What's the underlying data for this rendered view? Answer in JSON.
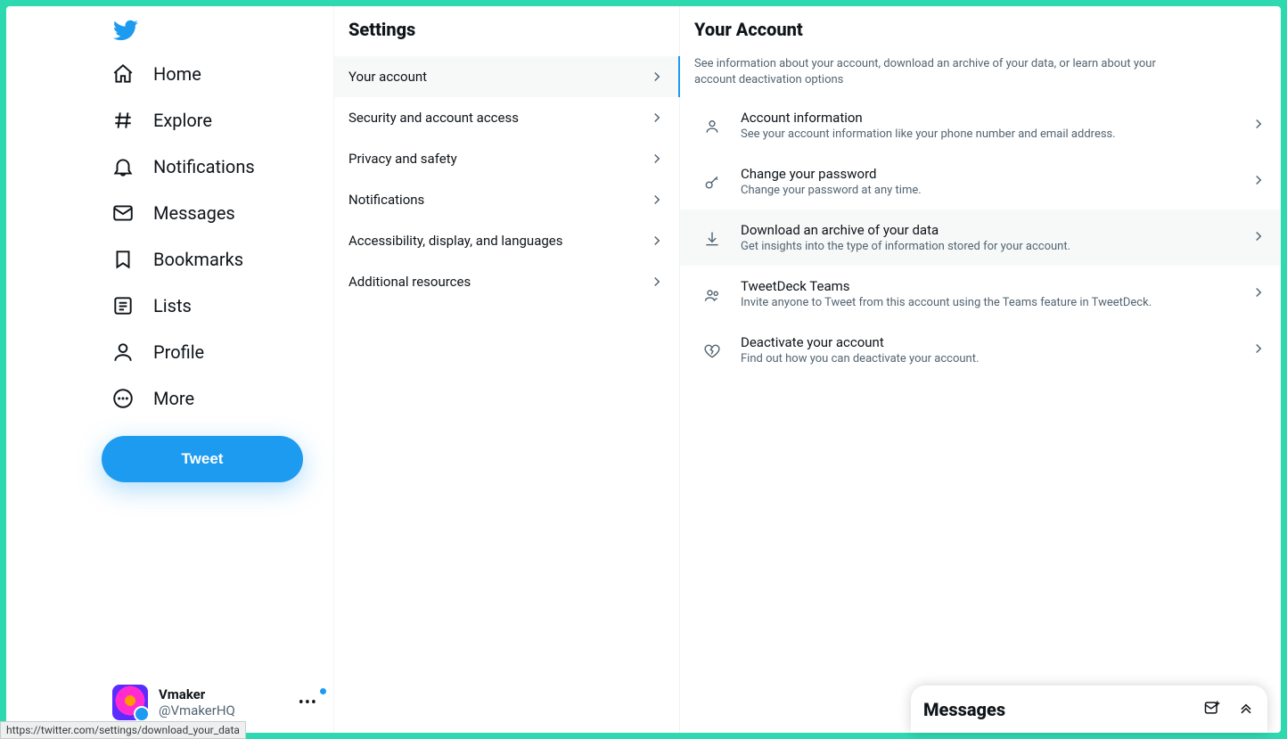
{
  "nav": {
    "items": [
      {
        "label": "Home"
      },
      {
        "label": "Explore"
      },
      {
        "label": "Notifications"
      },
      {
        "label": "Messages"
      },
      {
        "label": "Bookmarks"
      },
      {
        "label": "Lists"
      },
      {
        "label": "Profile"
      },
      {
        "label": "More"
      }
    ],
    "tweet_label": "Tweet"
  },
  "account": {
    "name": "Vmaker",
    "handle": "@VmakerHQ"
  },
  "settings": {
    "title": "Settings",
    "items": [
      {
        "label": "Your account"
      },
      {
        "label": "Security and account access"
      },
      {
        "label": "Privacy and safety"
      },
      {
        "label": "Notifications"
      },
      {
        "label": "Accessibility, display, and languages"
      },
      {
        "label": "Additional resources"
      }
    ]
  },
  "detail": {
    "title": "Your Account",
    "description": "See information about your account, download an archive of your data, or learn about your account deactivation options",
    "options": [
      {
        "title": "Account information",
        "sub": "See your account information like your phone number and email address."
      },
      {
        "title": "Change your password",
        "sub": "Change your password at any time."
      },
      {
        "title": "Download an archive of your data",
        "sub": "Get insights into the type of information stored for your account."
      },
      {
        "title": "TweetDeck Teams",
        "sub": "Invite anyone to Tweet from this account using the Teams feature in TweetDeck."
      },
      {
        "title": "Deactivate your account",
        "sub": "Find out how you can deactivate your account."
      }
    ]
  },
  "statusbar": {
    "url": "https://twitter.com/settings/download_your_data"
  },
  "messages_drawer": {
    "title": "Messages"
  }
}
